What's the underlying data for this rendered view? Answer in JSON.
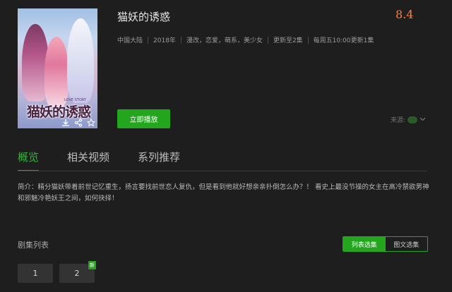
{
  "show": {
    "title": "猫妖的诱惑",
    "score": "8.4",
    "meta": [
      "中国大陆",
      "2018年",
      "漫改，恋爱，萌系，美少女",
      "更新至2集",
      "每周五10:00更新1集"
    ],
    "poster_title_art": "猫妖的诱惑",
    "poster_subtitle_art": "LOVE STORY"
  },
  "actions": {
    "play_label": "立即播放",
    "source_label": "来源:"
  },
  "tabs": [
    {
      "label": "概览",
      "active": true
    },
    {
      "label": "相关视频",
      "active": false
    },
    {
      "label": "系列推荐",
      "active": false
    }
  ],
  "synopsis": "简介：精分猫妖带着前世记忆重生，扬言要找前世恋人复仇，但是看到他就好想亲亲扑倒怎么办？！ 看史上最没节操的女主在高冷禁欲男神和邪魅冷艳妖王之间，如何抉择！",
  "episodes": {
    "label": "剧集列表",
    "view_list": "列表选集",
    "view_grid": "图文选集",
    "items": [
      {
        "number": "1",
        "badge": ""
      },
      {
        "number": "2",
        "badge": "新"
      }
    ]
  },
  "colors": {
    "accent": "#23a51e",
    "score": "#ff7f3f",
    "background": "#1e1e1e"
  }
}
